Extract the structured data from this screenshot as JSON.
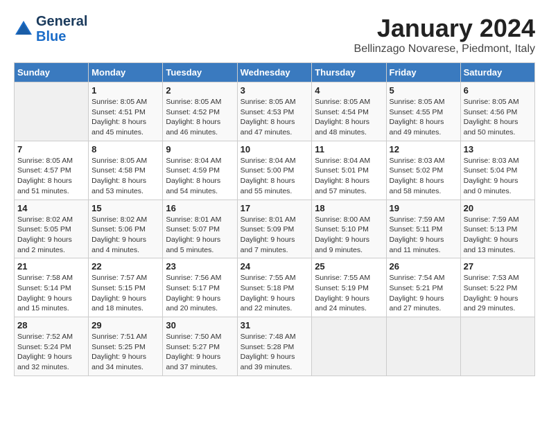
{
  "header": {
    "logo_line1": "General",
    "logo_line2": "Blue",
    "month": "January 2024",
    "location": "Bellinzago Novarese, Piedmont, Italy"
  },
  "days_of_week": [
    "Sunday",
    "Monday",
    "Tuesday",
    "Wednesday",
    "Thursday",
    "Friday",
    "Saturday"
  ],
  "weeks": [
    [
      {
        "day": "",
        "info": ""
      },
      {
        "day": "1",
        "info": "Sunrise: 8:05 AM\nSunset: 4:51 PM\nDaylight: 8 hours\nand 45 minutes."
      },
      {
        "day": "2",
        "info": "Sunrise: 8:05 AM\nSunset: 4:52 PM\nDaylight: 8 hours\nand 46 minutes."
      },
      {
        "day": "3",
        "info": "Sunrise: 8:05 AM\nSunset: 4:53 PM\nDaylight: 8 hours\nand 47 minutes."
      },
      {
        "day": "4",
        "info": "Sunrise: 8:05 AM\nSunset: 4:54 PM\nDaylight: 8 hours\nand 48 minutes."
      },
      {
        "day": "5",
        "info": "Sunrise: 8:05 AM\nSunset: 4:55 PM\nDaylight: 8 hours\nand 49 minutes."
      },
      {
        "day": "6",
        "info": "Sunrise: 8:05 AM\nSunset: 4:56 PM\nDaylight: 8 hours\nand 50 minutes."
      }
    ],
    [
      {
        "day": "7",
        "info": "Sunrise: 8:05 AM\nSunset: 4:57 PM\nDaylight: 8 hours\nand 51 minutes."
      },
      {
        "day": "8",
        "info": "Sunrise: 8:05 AM\nSunset: 4:58 PM\nDaylight: 8 hours\nand 53 minutes."
      },
      {
        "day": "9",
        "info": "Sunrise: 8:04 AM\nSunset: 4:59 PM\nDaylight: 8 hours\nand 54 minutes."
      },
      {
        "day": "10",
        "info": "Sunrise: 8:04 AM\nSunset: 5:00 PM\nDaylight: 8 hours\nand 55 minutes."
      },
      {
        "day": "11",
        "info": "Sunrise: 8:04 AM\nSunset: 5:01 PM\nDaylight: 8 hours\nand 57 minutes."
      },
      {
        "day": "12",
        "info": "Sunrise: 8:03 AM\nSunset: 5:02 PM\nDaylight: 8 hours\nand 58 minutes."
      },
      {
        "day": "13",
        "info": "Sunrise: 8:03 AM\nSunset: 5:04 PM\nDaylight: 9 hours\nand 0 minutes."
      }
    ],
    [
      {
        "day": "14",
        "info": "Sunrise: 8:02 AM\nSunset: 5:05 PM\nDaylight: 9 hours\nand 2 minutes."
      },
      {
        "day": "15",
        "info": "Sunrise: 8:02 AM\nSunset: 5:06 PM\nDaylight: 9 hours\nand 4 minutes."
      },
      {
        "day": "16",
        "info": "Sunrise: 8:01 AM\nSunset: 5:07 PM\nDaylight: 9 hours\nand 5 minutes."
      },
      {
        "day": "17",
        "info": "Sunrise: 8:01 AM\nSunset: 5:09 PM\nDaylight: 9 hours\nand 7 minutes."
      },
      {
        "day": "18",
        "info": "Sunrise: 8:00 AM\nSunset: 5:10 PM\nDaylight: 9 hours\nand 9 minutes."
      },
      {
        "day": "19",
        "info": "Sunrise: 7:59 AM\nSunset: 5:11 PM\nDaylight: 9 hours\nand 11 minutes."
      },
      {
        "day": "20",
        "info": "Sunrise: 7:59 AM\nSunset: 5:13 PM\nDaylight: 9 hours\nand 13 minutes."
      }
    ],
    [
      {
        "day": "21",
        "info": "Sunrise: 7:58 AM\nSunset: 5:14 PM\nDaylight: 9 hours\nand 15 minutes."
      },
      {
        "day": "22",
        "info": "Sunrise: 7:57 AM\nSunset: 5:15 PM\nDaylight: 9 hours\nand 18 minutes."
      },
      {
        "day": "23",
        "info": "Sunrise: 7:56 AM\nSunset: 5:17 PM\nDaylight: 9 hours\nand 20 minutes."
      },
      {
        "day": "24",
        "info": "Sunrise: 7:55 AM\nSunset: 5:18 PM\nDaylight: 9 hours\nand 22 minutes."
      },
      {
        "day": "25",
        "info": "Sunrise: 7:55 AM\nSunset: 5:19 PM\nDaylight: 9 hours\nand 24 minutes."
      },
      {
        "day": "26",
        "info": "Sunrise: 7:54 AM\nSunset: 5:21 PM\nDaylight: 9 hours\nand 27 minutes."
      },
      {
        "day": "27",
        "info": "Sunrise: 7:53 AM\nSunset: 5:22 PM\nDaylight: 9 hours\nand 29 minutes."
      }
    ],
    [
      {
        "day": "28",
        "info": "Sunrise: 7:52 AM\nSunset: 5:24 PM\nDaylight: 9 hours\nand 32 minutes."
      },
      {
        "day": "29",
        "info": "Sunrise: 7:51 AM\nSunset: 5:25 PM\nDaylight: 9 hours\nand 34 minutes."
      },
      {
        "day": "30",
        "info": "Sunrise: 7:50 AM\nSunset: 5:27 PM\nDaylight: 9 hours\nand 37 minutes."
      },
      {
        "day": "31",
        "info": "Sunrise: 7:48 AM\nSunset: 5:28 PM\nDaylight: 9 hours\nand 39 minutes."
      },
      {
        "day": "",
        "info": ""
      },
      {
        "day": "",
        "info": ""
      },
      {
        "day": "",
        "info": ""
      }
    ]
  ]
}
